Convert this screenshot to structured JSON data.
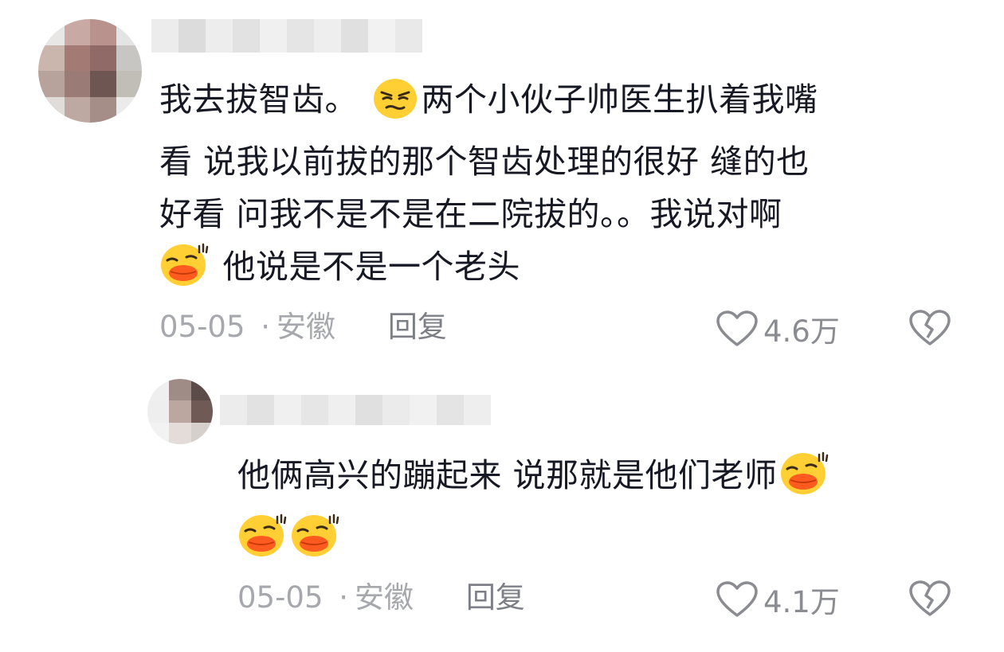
{
  "comment1": {
    "lines": [
      [
        "我去拔智齿。 ",
        "两个小伙子帅医生扒着我嘴"
      ],
      "看  说我以前拔的那个智齿处理的很好  缝的也",
      "好看   问我不是不是在二院拔的。。我说对啊",
      [
        "",
        " 他说是不是一个老头"
      ]
    ],
    "emoji1": "grimace-emoji",
    "emoji2": "blush-laugh-emoji",
    "date": "05-05",
    "separator": "·",
    "location": "安徽",
    "reply_label": "回复",
    "likes": "4.6万"
  },
  "comment2": {
    "lines": [
      "他俩高兴的蹦起来  说那就是他们老师",
      ""
    ],
    "emoji": "blush-laugh-emoji",
    "date": "05-05",
    "separator": "·",
    "location": "安徽",
    "reply_label": "回复",
    "likes": "4.1万"
  },
  "colors": {
    "text": "#161823",
    "meta": "#a6a8ad",
    "reply": "#7c7f86",
    "emoji_yellow": "#ffcf33"
  }
}
